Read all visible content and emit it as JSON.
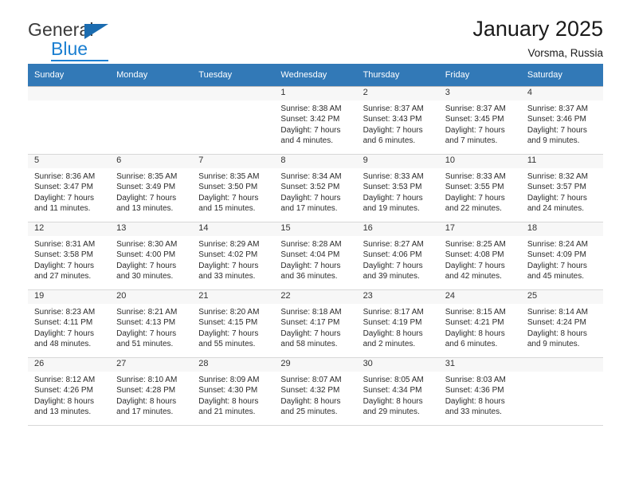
{
  "brand": {
    "name_part1": "General",
    "name_part2": "Blue",
    "logo_icon": "triangle-flag-icon",
    "accent_color": "#1b7fd1"
  },
  "header": {
    "title": "January 2025",
    "location": "Vorsma, Russia"
  },
  "theme": {
    "header_row_bg": "#3279b7",
    "header_row_text": "#ffffff",
    "daynum_bg_shaded": "#efefef",
    "daynum_bg_light": "#f7f7f7",
    "cell_border": "#bdbdbd"
  },
  "calendar": {
    "weekday_headers": [
      "Sunday",
      "Monday",
      "Tuesday",
      "Wednesday",
      "Thursday",
      "Friday",
      "Saturday"
    ],
    "weeks": [
      [
        {
          "day": "",
          "sunrise": "",
          "sunset": "",
          "daylight_line1": "",
          "daylight_line2": ""
        },
        {
          "day": "",
          "sunrise": "",
          "sunset": "",
          "daylight_line1": "",
          "daylight_line2": ""
        },
        {
          "day": "",
          "sunrise": "",
          "sunset": "",
          "daylight_line1": "",
          "daylight_line2": ""
        },
        {
          "day": "1",
          "sunrise": "Sunrise: 8:38 AM",
          "sunset": "Sunset: 3:42 PM",
          "daylight_line1": "Daylight: 7 hours",
          "daylight_line2": "and 4 minutes."
        },
        {
          "day": "2",
          "sunrise": "Sunrise: 8:37 AM",
          "sunset": "Sunset: 3:43 PM",
          "daylight_line1": "Daylight: 7 hours",
          "daylight_line2": "and 6 minutes."
        },
        {
          "day": "3",
          "sunrise": "Sunrise: 8:37 AM",
          "sunset": "Sunset: 3:45 PM",
          "daylight_line1": "Daylight: 7 hours",
          "daylight_line2": "and 7 minutes."
        },
        {
          "day": "4",
          "sunrise": "Sunrise: 8:37 AM",
          "sunset": "Sunset: 3:46 PM",
          "daylight_line1": "Daylight: 7 hours",
          "daylight_line2": "and 9 minutes."
        }
      ],
      [
        {
          "day": "5",
          "sunrise": "Sunrise: 8:36 AM",
          "sunset": "Sunset: 3:47 PM",
          "daylight_line1": "Daylight: 7 hours",
          "daylight_line2": "and 11 minutes."
        },
        {
          "day": "6",
          "sunrise": "Sunrise: 8:35 AM",
          "sunset": "Sunset: 3:49 PM",
          "daylight_line1": "Daylight: 7 hours",
          "daylight_line2": "and 13 minutes."
        },
        {
          "day": "7",
          "sunrise": "Sunrise: 8:35 AM",
          "sunset": "Sunset: 3:50 PM",
          "daylight_line1": "Daylight: 7 hours",
          "daylight_line2": "and 15 minutes."
        },
        {
          "day": "8",
          "sunrise": "Sunrise: 8:34 AM",
          "sunset": "Sunset: 3:52 PM",
          "daylight_line1": "Daylight: 7 hours",
          "daylight_line2": "and 17 minutes."
        },
        {
          "day": "9",
          "sunrise": "Sunrise: 8:33 AM",
          "sunset": "Sunset: 3:53 PM",
          "daylight_line1": "Daylight: 7 hours",
          "daylight_line2": "and 19 minutes."
        },
        {
          "day": "10",
          "sunrise": "Sunrise: 8:33 AM",
          "sunset": "Sunset: 3:55 PM",
          "daylight_line1": "Daylight: 7 hours",
          "daylight_line2": "and 22 minutes."
        },
        {
          "day": "11",
          "sunrise": "Sunrise: 8:32 AM",
          "sunset": "Sunset: 3:57 PM",
          "daylight_line1": "Daylight: 7 hours",
          "daylight_line2": "and 24 minutes."
        }
      ],
      [
        {
          "day": "12",
          "sunrise": "Sunrise: 8:31 AM",
          "sunset": "Sunset: 3:58 PM",
          "daylight_line1": "Daylight: 7 hours",
          "daylight_line2": "and 27 minutes."
        },
        {
          "day": "13",
          "sunrise": "Sunrise: 8:30 AM",
          "sunset": "Sunset: 4:00 PM",
          "daylight_line1": "Daylight: 7 hours",
          "daylight_line2": "and 30 minutes."
        },
        {
          "day": "14",
          "sunrise": "Sunrise: 8:29 AM",
          "sunset": "Sunset: 4:02 PM",
          "daylight_line1": "Daylight: 7 hours",
          "daylight_line2": "and 33 minutes."
        },
        {
          "day": "15",
          "sunrise": "Sunrise: 8:28 AM",
          "sunset": "Sunset: 4:04 PM",
          "daylight_line1": "Daylight: 7 hours",
          "daylight_line2": "and 36 minutes."
        },
        {
          "day": "16",
          "sunrise": "Sunrise: 8:27 AM",
          "sunset": "Sunset: 4:06 PM",
          "daylight_line1": "Daylight: 7 hours",
          "daylight_line2": "and 39 minutes."
        },
        {
          "day": "17",
          "sunrise": "Sunrise: 8:25 AM",
          "sunset": "Sunset: 4:08 PM",
          "daylight_line1": "Daylight: 7 hours",
          "daylight_line2": "and 42 minutes."
        },
        {
          "day": "18",
          "sunrise": "Sunrise: 8:24 AM",
          "sunset": "Sunset: 4:09 PM",
          "daylight_line1": "Daylight: 7 hours",
          "daylight_line2": "and 45 minutes."
        }
      ],
      [
        {
          "day": "19",
          "sunrise": "Sunrise: 8:23 AM",
          "sunset": "Sunset: 4:11 PM",
          "daylight_line1": "Daylight: 7 hours",
          "daylight_line2": "and 48 minutes."
        },
        {
          "day": "20",
          "sunrise": "Sunrise: 8:21 AM",
          "sunset": "Sunset: 4:13 PM",
          "daylight_line1": "Daylight: 7 hours",
          "daylight_line2": "and 51 minutes."
        },
        {
          "day": "21",
          "sunrise": "Sunrise: 8:20 AM",
          "sunset": "Sunset: 4:15 PM",
          "daylight_line1": "Daylight: 7 hours",
          "daylight_line2": "and 55 minutes."
        },
        {
          "day": "22",
          "sunrise": "Sunrise: 8:18 AM",
          "sunset": "Sunset: 4:17 PM",
          "daylight_line1": "Daylight: 7 hours",
          "daylight_line2": "and 58 minutes."
        },
        {
          "day": "23",
          "sunrise": "Sunrise: 8:17 AM",
          "sunset": "Sunset: 4:19 PM",
          "daylight_line1": "Daylight: 8 hours",
          "daylight_line2": "and 2 minutes."
        },
        {
          "day": "24",
          "sunrise": "Sunrise: 8:15 AM",
          "sunset": "Sunset: 4:21 PM",
          "daylight_line1": "Daylight: 8 hours",
          "daylight_line2": "and 6 minutes."
        },
        {
          "day": "25",
          "sunrise": "Sunrise: 8:14 AM",
          "sunset": "Sunset: 4:24 PM",
          "daylight_line1": "Daylight: 8 hours",
          "daylight_line2": "and 9 minutes."
        }
      ],
      [
        {
          "day": "26",
          "sunrise": "Sunrise: 8:12 AM",
          "sunset": "Sunset: 4:26 PM",
          "daylight_line1": "Daylight: 8 hours",
          "daylight_line2": "and 13 minutes."
        },
        {
          "day": "27",
          "sunrise": "Sunrise: 8:10 AM",
          "sunset": "Sunset: 4:28 PM",
          "daylight_line1": "Daylight: 8 hours",
          "daylight_line2": "and 17 minutes."
        },
        {
          "day": "28",
          "sunrise": "Sunrise: 8:09 AM",
          "sunset": "Sunset: 4:30 PM",
          "daylight_line1": "Daylight: 8 hours",
          "daylight_line2": "and 21 minutes."
        },
        {
          "day": "29",
          "sunrise": "Sunrise: 8:07 AM",
          "sunset": "Sunset: 4:32 PM",
          "daylight_line1": "Daylight: 8 hours",
          "daylight_line2": "and 25 minutes."
        },
        {
          "day": "30",
          "sunrise": "Sunrise: 8:05 AM",
          "sunset": "Sunset: 4:34 PM",
          "daylight_line1": "Daylight: 8 hours",
          "daylight_line2": "and 29 minutes."
        },
        {
          "day": "31",
          "sunrise": "Sunrise: 8:03 AM",
          "sunset": "Sunset: 4:36 PM",
          "daylight_line1": "Daylight: 8 hours",
          "daylight_line2": "and 33 minutes."
        },
        {
          "day": "",
          "sunrise": "",
          "sunset": "",
          "daylight_line1": "",
          "daylight_line2": ""
        }
      ]
    ]
  }
}
